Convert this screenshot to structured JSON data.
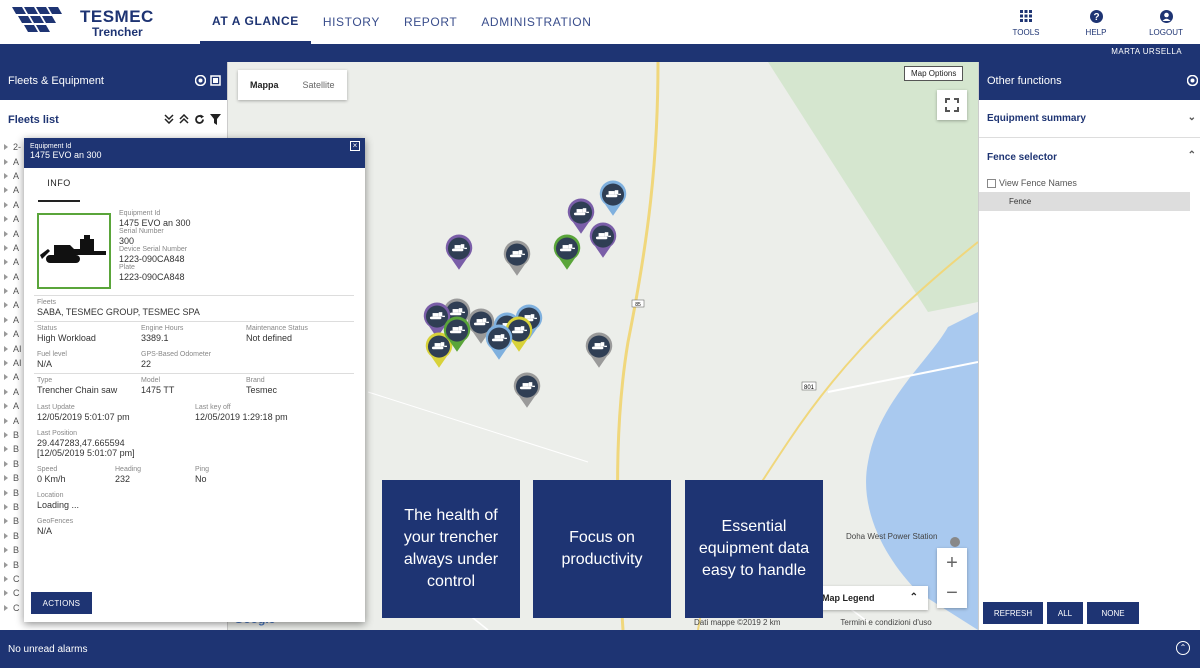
{
  "header": {
    "logo_line1": "TESMEC",
    "logo_line2": "Trencher",
    "nav": [
      "AT A GLANCE",
      "HISTORY",
      "REPORT",
      "ADMINISTRATION"
    ],
    "tools": [
      "TOOLS",
      "HELP",
      "LOGOUT"
    ]
  },
  "user": {
    "name": "MARTA URSELLA"
  },
  "left": {
    "title": "Fleets & Equipment",
    "list_title": "Fleets list",
    "rows": [
      "2-",
      "A",
      "A",
      "A",
      "A",
      "A",
      "A",
      "A",
      "A",
      "A",
      "A",
      "A",
      "A",
      "A",
      "AI",
      "AI",
      "A",
      "A",
      "A",
      "A",
      "B",
      "B",
      "B",
      "B",
      "B",
      "B",
      "B",
      "B",
      "B",
      "B",
      "C",
      "C",
      "C"
    ]
  },
  "map": {
    "tab_map": "Mappa",
    "tab_sat": "Satellite",
    "options": "Map Options",
    "legend": "Map Legend",
    "google": "Google",
    "footer_data": "Dati mappe ©2019 2 km",
    "footer_terms": "Termini e condizioni d'uso",
    "poi": "Doha West Power Station",
    "road": "801",
    "road2": "85"
  },
  "popup": {
    "head_label": "Equipment Id",
    "head_value": "1475 EVO an 300",
    "tab": "INFO",
    "equipment_id_label": "Equipment Id",
    "equipment_id": "1475 EVO an 300",
    "serial_label": "Serial Number",
    "serial": "300",
    "device_serial_label": "Device Serial Number",
    "device_serial": "1223-090CA848",
    "plate_label": "Plate",
    "plate": "1223-090CA848",
    "fleets_label": "Fleets",
    "fleets": "SABA, TESMEC GROUP, TESMEC SPA",
    "status_label": "Status",
    "status": "High Workload",
    "engine_label": "Engine Hours",
    "engine": "3389.1",
    "maint_label": "Maintenance Status",
    "maint": "Not defined",
    "fuel_label": "Fuel level",
    "fuel": "N/A",
    "odo_label": "GPS-Based Odometer",
    "odo": "22",
    "type_label": "Type",
    "type": "Trencher Chain saw",
    "model_label": "Model",
    "model": "1475 TT",
    "brand_label": "Brand",
    "brand": "Tesmec",
    "last_update_label": "Last Update",
    "last_update": "12/05/2019 5:01:07 pm",
    "last_key_label": "Last key off",
    "last_key": "12/05/2019 1:29:18 pm",
    "last_pos_label": "Last Position",
    "last_pos": "29.447283,47.665594",
    "last_pos_time": "[12/05/2019 5:01:07 pm]",
    "speed_label": "Speed",
    "speed": "0 Km/h",
    "heading_label": "Heading",
    "heading": "232",
    "ping_label": "Ping",
    "ping": "No",
    "location_label": "Location",
    "location": "Loading ...",
    "geofences_label": "GeoFences",
    "geofences": "N/A",
    "actions": "ACTIONS"
  },
  "promos": [
    "The health of your trencher always under control",
    "Focus on productivity",
    "Essential equipment data easy to handle"
  ],
  "right": {
    "title": "Other functions",
    "summary": "Equipment summary",
    "fence_selector": "Fence selector",
    "view_fence": "View Fence Names",
    "fence": "Fence",
    "refresh": "REFRESH",
    "all": "ALL",
    "none": "NONE"
  },
  "footer": {
    "alarms": "No unread alarms"
  },
  "colors": {
    "brand": "#1e3473",
    "pin_dark": "#2f3e54",
    "pin_purple": "#7a5ea8",
    "pin_green": "#5aa53a",
    "pin_blue": "#7fb0de",
    "pin_grey": "#9a9a9a",
    "pin_yellow": "#d8d23a"
  }
}
